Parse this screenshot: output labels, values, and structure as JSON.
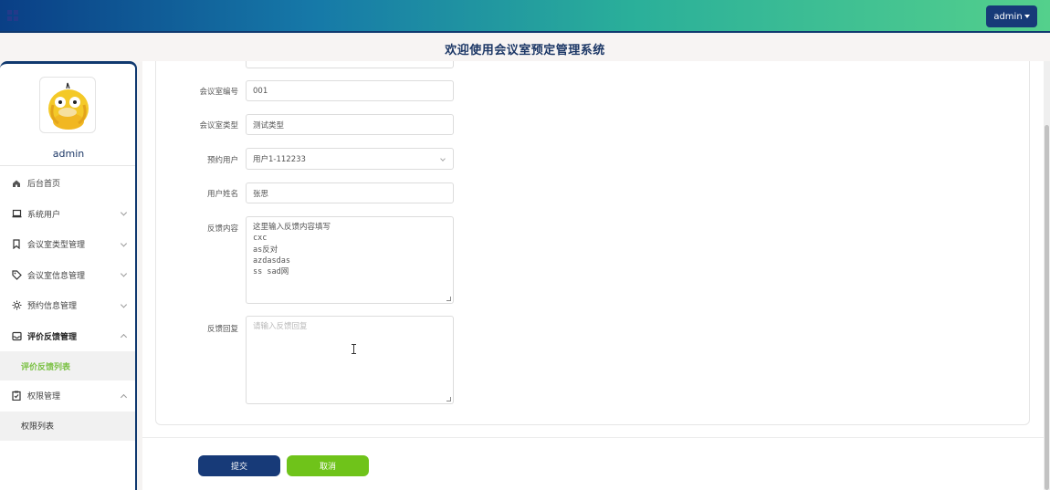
{
  "header": {
    "admin_label": "admin",
    "title": "欢迎使用会议室预定管理系统"
  },
  "sidebar": {
    "username": "admin",
    "items": [
      {
        "label": "后台首页",
        "icon": "home-icon"
      },
      {
        "label": "系统用户",
        "icon": "laptop-icon"
      },
      {
        "label": "会议室类型管理",
        "icon": "bookmark-icon"
      },
      {
        "label": "会议室信息管理",
        "icon": "tag-icon"
      },
      {
        "label": "预约信息管理",
        "icon": "sun-icon"
      },
      {
        "label": "评价反馈管理",
        "icon": "inbox-icon",
        "expanded": true
      },
      {
        "label": "评价反馈列表",
        "sub": true,
        "active": true
      },
      {
        "label": "权限管理",
        "icon": "clipboard-check-icon",
        "expanded": true
      },
      {
        "label": "权限列表",
        "sub": true
      }
    ]
  },
  "form": {
    "room_number_label": "会议室编号",
    "room_number_value": "001",
    "room_type_label": "会议室类型",
    "room_type_value": "测试类型",
    "booking_user_label": "预约用户",
    "booking_user_value": "用户1-112233",
    "user_name_label": "用户姓名",
    "user_name_value": "张思",
    "feedback_label": "反馈内容",
    "feedback_lines": [
      "这里输入反馈内容填写",
      "cxc",
      "as反对",
      "azdasdas",
      "ss sad网"
    ],
    "reply_label": "反馈回复",
    "reply_placeholder": "请输入反馈回复"
  },
  "buttons": {
    "submit": "提交",
    "cancel": "取消"
  },
  "colors": {
    "primary": "#173a78",
    "accent_green": "#6fc31a",
    "active_menu": "#7ac143"
  }
}
